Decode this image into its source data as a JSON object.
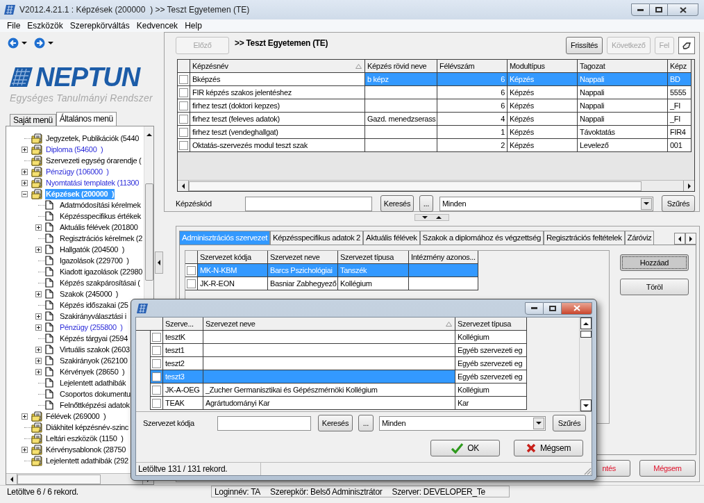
{
  "window": {
    "title": "V2012.4.21.1 : Képzések (200000  ) >> Teszt Egyetemen (TE)"
  },
  "menu": [
    "File",
    "Eszközök",
    "Szerepkörváltás",
    "Kedvencek",
    "Help"
  ],
  "logo": {
    "name": "NEPTUN",
    "tagline": "Egységes Tanulmányi Rendszer"
  },
  "menu_tabs": [
    {
      "label": "Saját menü",
      "selected": false
    },
    {
      "label": "Általános menü",
      "selected": true
    }
  ],
  "tree": [
    {
      "label": "Jegyzetek, Publikációk (5440",
      "kind": "leaf",
      "link": false,
      "selected": false
    },
    {
      "label": "Diploma (54600  )",
      "kind": "collapsed",
      "link": true,
      "selected": false
    },
    {
      "label": "Szervezeti egység órarendje (",
      "kind": "leaf",
      "link": false,
      "selected": false
    },
    {
      "label": "Pénzügy (106000  )",
      "kind": "collapsed",
      "link": true,
      "selected": false
    },
    {
      "label": "Nyomtatási templatek (11300",
      "kind": "collapsed",
      "link": true,
      "selected": false
    },
    {
      "label": "Képzések (200000  )",
      "kind": "expanded",
      "selected": true,
      "children": [
        {
          "label": "Adatmódosítási kérelmek",
          "kind": "leaf",
          "link": false,
          "selected": false
        },
        {
          "label": "Képzésspecifikus értékek",
          "kind": "leaf",
          "link": false,
          "selected": false
        },
        {
          "label": "Aktuális félévek (201800",
          "kind": "collapsed",
          "link": false,
          "selected": false
        },
        {
          "label": "Regisztrációs kérelmek (2",
          "kind": "leaf",
          "link": false,
          "selected": false
        },
        {
          "label": "Hallgatók (204500  )",
          "kind": "collapsed",
          "link": false,
          "selected": false
        },
        {
          "label": "Igazolások (229700  )",
          "kind": "leaf",
          "link": false,
          "selected": false
        },
        {
          "label": "Kiadott igazolások (22980",
          "kind": "leaf",
          "link": false,
          "selected": false
        },
        {
          "label": "Képzés szakpárosításai (",
          "kind": "leaf",
          "link": false,
          "selected": false
        },
        {
          "label": "Szakok (245000  )",
          "kind": "collapsed",
          "link": false,
          "selected": false
        },
        {
          "label": "Képzés időszakai (25",
          "kind": "leaf",
          "link": false,
          "selected": false
        },
        {
          "label": "Szakirányválasztási i",
          "kind": "collapsed",
          "link": false,
          "selected": false
        },
        {
          "label": "Pénzügy (255800  )",
          "kind": "collapsed",
          "link": true,
          "selected": false
        },
        {
          "label": "Képzés tárgyai (2594",
          "kind": "leaf",
          "link": false,
          "selected": false
        },
        {
          "label": "Virtuális szakok (2603",
          "kind": "collapsed",
          "link": false,
          "selected": false
        },
        {
          "label": "Szakirányok (262100",
          "kind": "collapsed",
          "link": false,
          "selected": false
        },
        {
          "label": "Kérvények (28650  )",
          "kind": "collapsed",
          "link": false,
          "selected": false
        },
        {
          "label": "Lejelentett adathibák",
          "kind": "leaf",
          "link": false,
          "selected": false
        },
        {
          "label": "Csoportos dokumentu",
          "kind": "leaf",
          "link": false,
          "selected": false
        },
        {
          "label": "Felnőttképzési adatok",
          "kind": "leaf",
          "link": false,
          "selected": false
        }
      ]
    },
    {
      "label": "Félévek (269000  )",
      "kind": "collapsed",
      "link": false,
      "selected": false
    },
    {
      "label": "Diákhitel képzésnév-szinc",
      "kind": "leaf",
      "link": false,
      "selected": false
    },
    {
      "label": "Leltári eszközök (1150  )",
      "kind": "leaf",
      "link": false,
      "selected": false
    },
    {
      "label": "Kérvénysablonok (28750",
      "kind": "collapsed",
      "link": false,
      "selected": false
    },
    {
      "label": "Lejelentett adathibák (292",
      "kind": "leaf",
      "link": false,
      "selected": false
    }
  ],
  "toolbar": {
    "previous": {
      "label": "Előző",
      "disabled": true
    },
    "title": ">> Teszt Egyetemen (TE)",
    "buttons": [
      {
        "label": "Frissítés",
        "disabled": false
      },
      {
        "label": "Következő",
        "disabled": true
      },
      {
        "label": "Fel",
        "disabled": true
      }
    ]
  },
  "table": {
    "columns": [
      {
        "label": "Képzésnév",
        "sorted": true
      },
      {
        "label": "Képzés rövid neve",
        "sorted": false
      },
      {
        "label": "Félévszám",
        "sorted": false
      },
      {
        "label": "Modultípus",
        "sorted": false
      },
      {
        "label": "Tagozat",
        "sorted": false
      },
      {
        "label": "Képz",
        "sorted": false
      }
    ],
    "rows": [
      {
        "cells": [
          "Bképzés",
          "b képz",
          "6",
          "Képzés",
          "Nappali",
          "BD"
        ],
        "checked": false,
        "selected": true
      },
      {
        "cells": [
          "FIR képzés szakos jelentéshez",
          null,
          "6",
          "Képzés",
          "Nappali",
          "5555"
        ],
        "checked": false,
        "selected": false
      },
      {
        "cells": [
          "firhez teszt (doktori kepzes)",
          null,
          "6",
          "Képzés",
          "Nappali",
          "_FI"
        ],
        "checked": false,
        "selected": false
      },
      {
        "cells": [
          "firhez teszt (feleves adatok)",
          "Gazd. menedzserass",
          "4",
          "Képzés",
          "Nappali",
          "_FI"
        ],
        "checked": false,
        "selected": false
      },
      {
        "cells": [
          "firhez teszt (vendeghallgat)",
          null,
          "1",
          "Képzés",
          "Távoktatás",
          "FIR4"
        ],
        "checked": false,
        "selected": false
      },
      {
        "cells": [
          "Oktatás-szervezés modul teszt szak",
          null,
          "2",
          "Képzés",
          "Levelező",
          "001"
        ],
        "checked": false,
        "selected": false
      }
    ]
  },
  "filter": {
    "label": "Képzéskód",
    "search_button": "Keresés",
    "more_button": "...",
    "select": "Minden",
    "filter_button": "Szűrés"
  },
  "detail_tabs": [
    {
      "label": "Adminisztrációs szervezet",
      "selected": true
    },
    {
      "label": "Képzésspecifikus adatok 2",
      "selected": false
    },
    {
      "label": "Aktuális félévek",
      "selected": false
    },
    {
      "label": "Szakok a diplomához és végzettség",
      "selected": false
    },
    {
      "label": "Regisztrációs feltételek",
      "selected": false
    },
    {
      "label": "Záróviz",
      "selected": false
    }
  ],
  "org_table": {
    "columns": [
      {
        "label": "Szervezet kódja",
        "sorted": false
      },
      {
        "label": "Szervezet neve",
        "sorted": false
      },
      {
        "label": "Szervezet típusa",
        "sorted": false
      },
      {
        "label": "Intézmény azonos...",
        "sorted": false
      }
    ],
    "rows": [
      {
        "cells": [
          "MK-N-KBM",
          "Barcs Pszichológiai",
          "Tanszék",
          null
        ],
        "checked": false,
        "selected": true
      },
      {
        "cells": [
          "JK-R-EON",
          "Basniar Zabhegyező",
          "Kollégium",
          null
        ],
        "checked": false,
        "selected": false
      }
    ]
  },
  "side_buttons": [
    {
      "label": "Hozzáad",
      "focused": true
    },
    {
      "label": "Töröl",
      "focused": false
    }
  ],
  "footer_buttons": [
    "ntés",
    "Mégsem"
  ],
  "status_bar": {
    "records": "Letöltve 6 / 6 rekord.",
    "login": "Loginnév: TA",
    "role": "Szerepkör: Belső Adminisztrátor",
    "server": "Szerver: DEVELOPER_Te"
  },
  "dialog": {
    "table": {
      "columns": [
        {
          "label": "Szerve...",
          "sorted": false
        },
        {
          "label": "Szervezet neve",
          "sorted": true
        },
        {
          "label": "Szervezet típusa",
          "sorted": false
        }
      ],
      "rows": [
        {
          "cells": [
            "tesztK",
            null,
            "Kollégium"
          ],
          "checked": false,
          "selected": false
        },
        {
          "cells": [
            "teszt1",
            null,
            "Egyéb szervezeti eg"
          ],
          "checked": false,
          "selected": false
        },
        {
          "cells": [
            "teszt2",
            null,
            "Egyéb szervezeti eg"
          ],
          "checked": false,
          "selected": false
        },
        {
          "cells": [
            "teszt3",
            null,
            "Egyéb szervezeti eg"
          ],
          "checked": false,
          "selected": true
        },
        {
          "cells": [
            "JK-A-OEG",
            "_Zucher Germanisztikai és Gépészmérnöki Kollégium",
            "Kollégium"
          ],
          "checked": false,
          "selected": false
        },
        {
          "cells": [
            "TEAK",
            "Agrártudományi Kar",
            "Kar"
          ],
          "checked": false,
          "selected": false
        }
      ]
    },
    "filter": {
      "label": "Szervezet kódja",
      "search_button": "Keresés",
      "more_button": "...",
      "select": "Minden",
      "filter_button": "Szűrés"
    },
    "buttons": [
      {
        "label": "OK",
        "kind": "ok"
      },
      {
        "label": "Mégsem",
        "kind": "cancel"
      }
    ],
    "status": "Letöltve 131 / 131 rekord."
  }
}
